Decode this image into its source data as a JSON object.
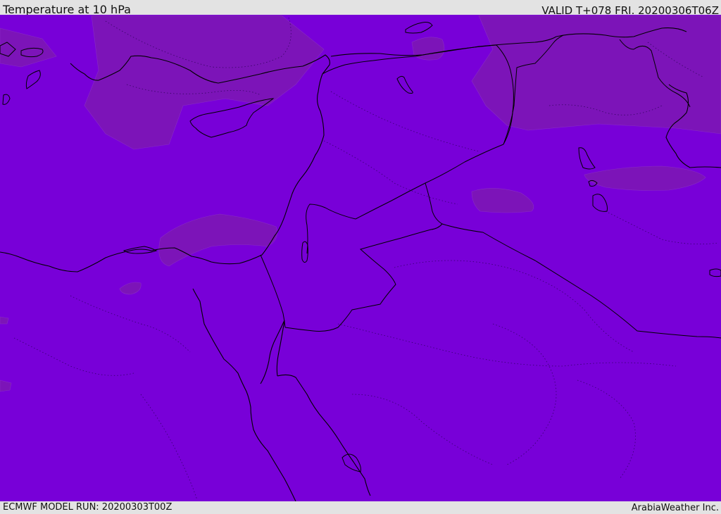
{
  "header": {
    "title": "Temperature at 10 hPa",
    "valid": "VALID T+078 FRI. 20200306T06Z"
  },
  "footer": {
    "model_run": "ECMWF MODEL RUN: 20200303T00Z",
    "provider": "ArabiaWeather Inc."
  },
  "map": {
    "field": "Temperature at 10 hPa",
    "region": "Eastern Mediterranean / Middle East",
    "colors": {
      "background_fill": "#7800d8",
      "warm_patch_fill": "#7c14b8",
      "coastline": "#000000",
      "border": "#000000"
    }
  }
}
